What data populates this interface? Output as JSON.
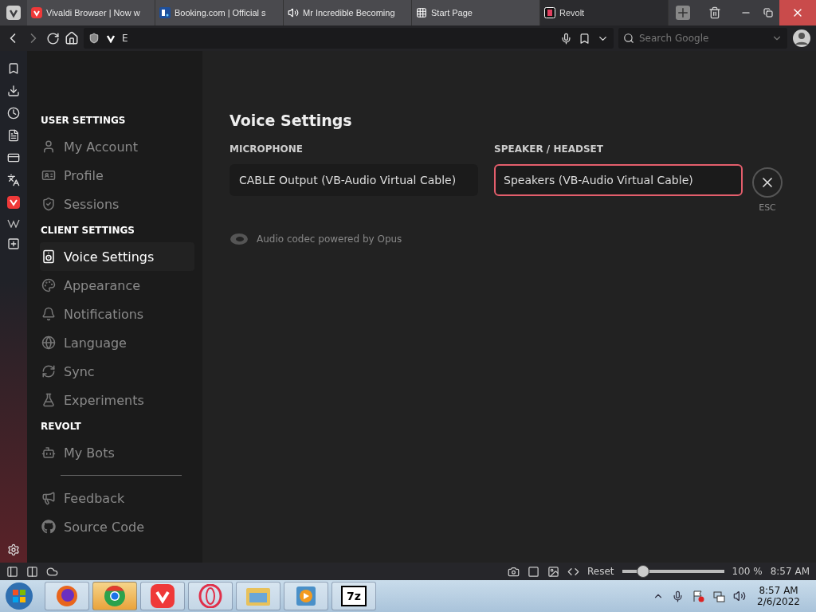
{
  "tabs": [
    {
      "title": "Vivaldi Browser | Now w",
      "kind": "vivaldi",
      "selected": false
    },
    {
      "title": "Booking.com | Official s",
      "kind": "booking",
      "selected": false
    },
    {
      "title": "Mr Incredible Becoming",
      "kind": "audio",
      "selected": false
    },
    {
      "title": "Start Page",
      "kind": "grid",
      "selected": false
    },
    {
      "title": "Revolt",
      "kind": "revolt",
      "selected": true
    }
  ],
  "address": {
    "value": "E"
  },
  "search": {
    "placeholder": "Search Google"
  },
  "sidebar": {
    "sections": [
      {
        "heading": "USER SETTINGS",
        "items": [
          {
            "label": "My Account",
            "kind": "user",
            "selected": false
          },
          {
            "label": "Profile",
            "kind": "card",
            "selected": false
          },
          {
            "label": "Sessions",
            "kind": "shield",
            "selected": false
          }
        ]
      },
      {
        "heading": "CLIENT SETTINGS",
        "items": [
          {
            "label": "Voice Settings",
            "kind": "speaker",
            "selected": true
          },
          {
            "label": "Appearance",
            "kind": "palette",
            "selected": false
          },
          {
            "label": "Notifications",
            "kind": "bell",
            "selected": false
          },
          {
            "label": "Language",
            "kind": "globe",
            "selected": false
          },
          {
            "label": "Sync",
            "kind": "sync",
            "selected": false
          },
          {
            "label": "Experiments",
            "kind": "flask",
            "selected": false
          }
        ]
      },
      {
        "heading": "REVOLT",
        "items": [
          {
            "label": "My Bots",
            "kind": "bot",
            "selected": false
          }
        ]
      }
    ],
    "links": [
      {
        "label": "Feedback",
        "kind": "megaphone"
      },
      {
        "label": "Source Code",
        "kind": "github"
      }
    ]
  },
  "content": {
    "title": "Voice Settings",
    "fields": [
      {
        "label": "MICROPHONE",
        "value": "CABLE Output (VB-Audio Virtual Cable)",
        "focused": false
      },
      {
        "label": "SPEAKER / HEADSET",
        "value": "Speakers (VB-Audio Virtual Cable)",
        "focused": true
      }
    ],
    "note": "Audio codec powered by Opus",
    "close_label": "ESC"
  },
  "status_bar": {
    "reset": "Reset",
    "zoom": {
      "level": 0.2
    },
    "zoom_text": "100 %",
    "time": "8:57 AM"
  },
  "taskbar": {
    "apps": [
      {
        "kind": "firefox",
        "active": false
      },
      {
        "kind": "chrome",
        "active": true
      },
      {
        "kind": "vivaldi",
        "active": false
      },
      {
        "kind": "opera",
        "active": false
      },
      {
        "kind": "folder",
        "active": false
      },
      {
        "kind": "media",
        "active": false
      },
      {
        "kind": "archive",
        "label": "7z",
        "active": false
      }
    ],
    "time": "8:57 AM",
    "date": "2/6/2022"
  }
}
